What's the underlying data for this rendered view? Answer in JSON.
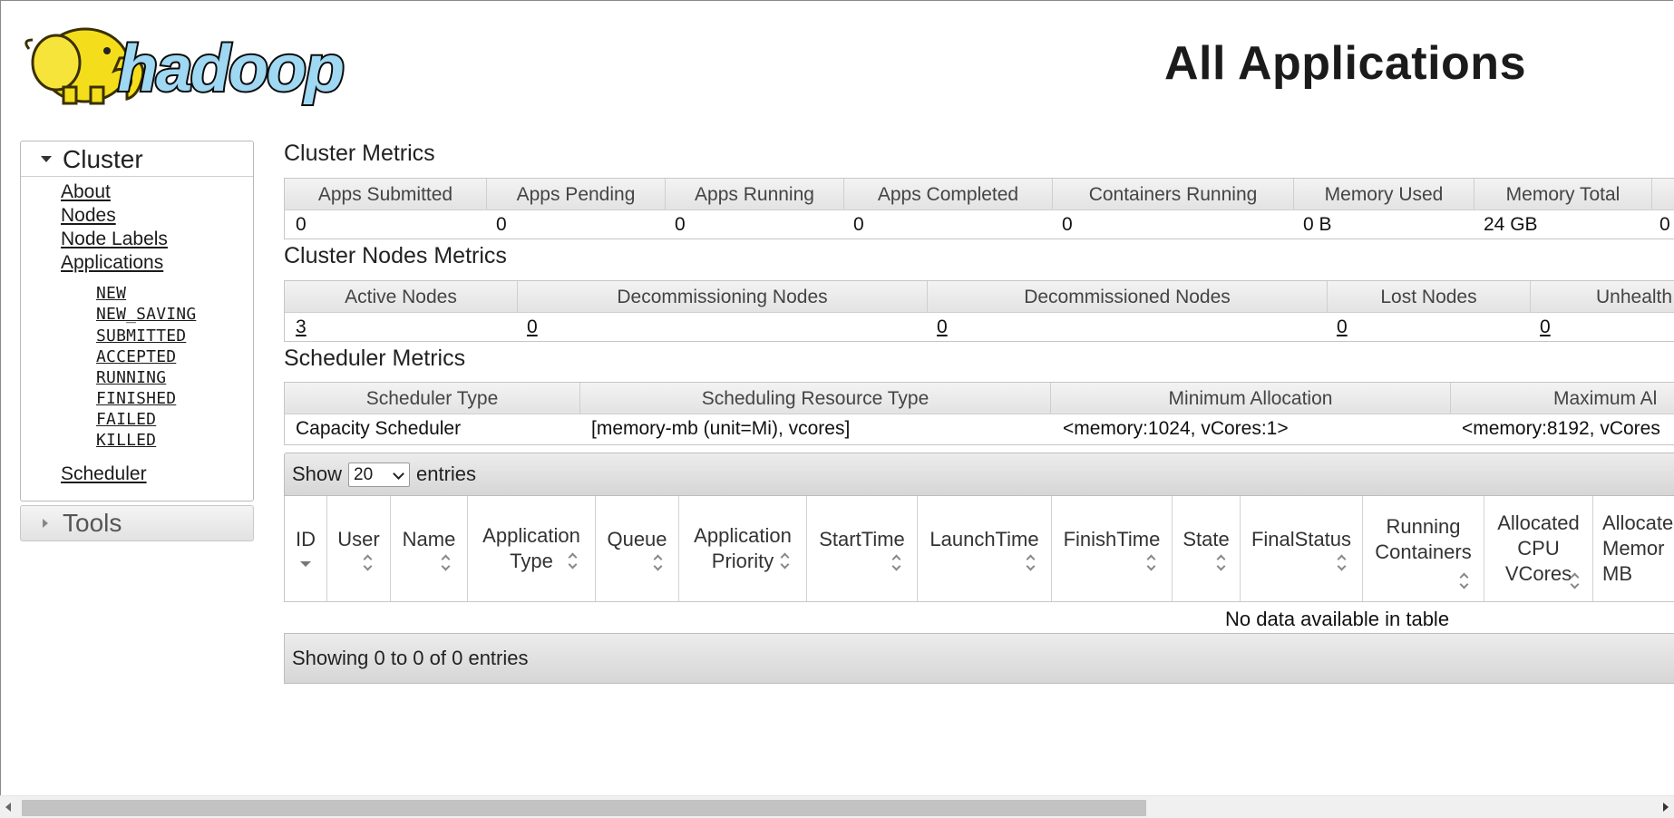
{
  "header": {
    "logo_text": "hadoop",
    "title": "All Applications"
  },
  "sidebar": {
    "cluster_label": "Cluster",
    "cluster_links": [
      "About",
      "Nodes",
      "Node Labels",
      "Applications"
    ],
    "app_states": [
      "NEW",
      "NEW_SAVING",
      "SUBMITTED",
      "ACCEPTED",
      "RUNNING",
      "FINISHED",
      "FAILED",
      "KILLED"
    ],
    "scheduler_link": "Scheduler",
    "tools_label": "Tools"
  },
  "cluster_metrics": {
    "title": "Cluster Metrics",
    "headers": [
      "Apps Submitted",
      "Apps Pending",
      "Apps Running",
      "Apps Completed",
      "Containers Running",
      "Memory Used",
      "Memory Total"
    ],
    "values": [
      "0",
      "0",
      "0",
      "0",
      "0",
      "0 B",
      "24 GB",
      "0"
    ]
  },
  "cluster_nodes_metrics": {
    "title": "Cluster Nodes Metrics",
    "headers": [
      "Active Nodes",
      "Decommissioning Nodes",
      "Decommissioned Nodes",
      "Lost Nodes",
      "Unhealth"
    ],
    "values": [
      "3",
      "0",
      "0",
      "0",
      "0"
    ]
  },
  "scheduler_metrics": {
    "title": "Scheduler Metrics",
    "headers": [
      "Scheduler Type",
      "Scheduling Resource Type",
      "Minimum Allocation",
      "Maximum Al"
    ],
    "values": [
      "Capacity Scheduler",
      "[memory-mb (unit=Mi), vcores]",
      "<memory:1024, vCores:1>",
      "<memory:8192, vCores"
    ]
  },
  "apps_table": {
    "show_label": "Show",
    "page_size": "20",
    "entries_label": "entries",
    "columns": [
      "ID",
      "User",
      "Name",
      "Application\nType",
      "Queue",
      "Application\nPriority",
      "StartTime",
      "LaunchTime",
      "FinishTime",
      "State",
      "FinalStatus",
      "Running\nContainers",
      "Allocated\nCPU\nVCores",
      "Allocate\nMemor\nMB"
    ],
    "empty_message": "No data available in table",
    "info": "Showing 0 to 0 of 0 entries"
  }
}
